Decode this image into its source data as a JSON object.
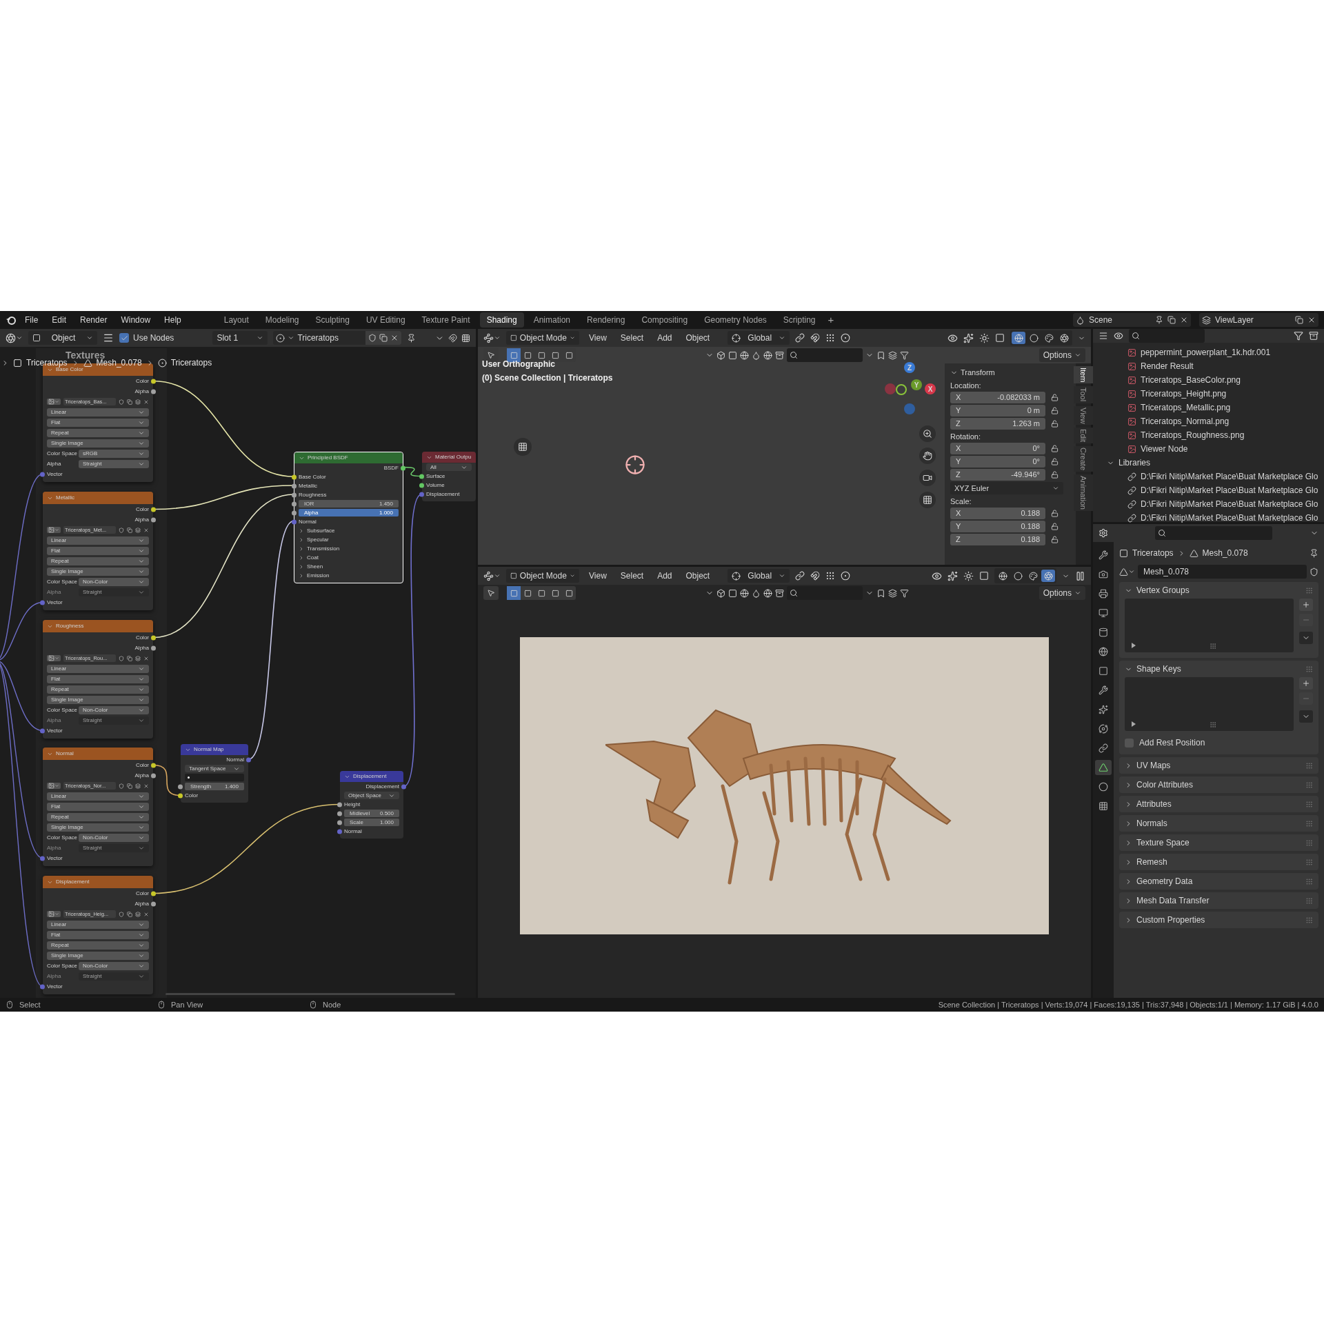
{
  "menubar": {
    "items": [
      "File",
      "Edit",
      "Render",
      "Window",
      "Help"
    ],
    "workspaces": [
      {
        "label": "Layout",
        "selected": false
      },
      {
        "label": "Modeling",
        "selected": false
      },
      {
        "label": "Sculpting",
        "selected": false
      },
      {
        "label": "UV Editing",
        "selected": false
      },
      {
        "label": "Texture Paint",
        "selected": false
      },
      {
        "label": "Shading",
        "selected": true
      },
      {
        "label": "Animation",
        "selected": false
      },
      {
        "label": "Rendering",
        "selected": false
      },
      {
        "label": "Compositing",
        "selected": false
      },
      {
        "label": "Geometry Nodes",
        "selected": false
      },
      {
        "label": "Scripting",
        "selected": false
      }
    ],
    "add_tab": "+",
    "scene": "Scene",
    "view_layer": "ViewLayer"
  },
  "node_editor": {
    "header": {
      "mode": "Object",
      "use_nodes": {
        "label": "Use Nodes",
        "checked": true
      },
      "slot": "Slot 1",
      "material": "Triceratops"
    },
    "frame_label": "Textures",
    "breadcrumb": [
      "Triceratops",
      "Mesh_0.078",
      "Triceratops"
    ],
    "image_nodes": [
      {
        "label": "Base Color",
        "image": "Triceratops_Bas...",
        "interpolation": "Linear",
        "projection": "Flat",
        "extension": "Repeat",
        "source": "Single Image",
        "color_space_label": "Color Space",
        "color_space": "sRGB",
        "alpha_label": "Alpha",
        "alpha": "Straight",
        "alpha_enabled": true,
        "outputs": [
          "Color",
          "Alpha"
        ],
        "input": "Vector"
      },
      {
        "label": "Metallic",
        "image": "Triceratops_Met...",
        "interpolation": "Linear",
        "projection": "Flat",
        "extension": "Repeat",
        "source": "Single Image",
        "color_space_label": "Color Space",
        "color_space": "Non-Color",
        "alpha_label": "Alpha",
        "alpha": "Straight",
        "alpha_enabled": false,
        "outputs": [
          "Color",
          "Alpha"
        ],
        "input": "Vector"
      },
      {
        "label": "Roughness",
        "image": "Triceratops_Rou...",
        "interpolation": "Linear",
        "projection": "Flat",
        "extension": "Repeat",
        "source": "Single Image",
        "color_space_label": "Color Space",
        "color_space": "Non-Color",
        "alpha_label": "Alpha",
        "alpha": "Straight",
        "alpha_enabled": false,
        "outputs": [
          "Color",
          "Alpha"
        ],
        "input": "Vector"
      },
      {
        "label": "Normal",
        "image": "Triceratops_Nor...",
        "interpolation": "Linear",
        "projection": "Flat",
        "extension": "Repeat",
        "source": "Single Image",
        "color_space_label": "Color Space",
        "color_space": "Non-Color",
        "alpha_label": "Alpha",
        "alpha": "Straight",
        "alpha_enabled": false,
        "outputs": [
          "Color",
          "Alpha"
        ],
        "input": "Vector"
      },
      {
        "label": "Displacement",
        "image": "Triceratops_Heig...",
        "interpolation": "Linear",
        "projection": "Flat",
        "extension": "Repeat",
        "source": "Single Image",
        "color_space_label": "Color Space",
        "color_space": "Non-Color",
        "alpha_label": "Alpha",
        "alpha": "Straight",
        "alpha_enabled": false,
        "outputs": [
          "Color",
          "Alpha"
        ],
        "input": "Vector"
      }
    ],
    "principled": {
      "title": "Principled BSDF",
      "output": "BSDF",
      "inputs": [
        "Base Color",
        "Metallic",
        "Roughness"
      ],
      "sliders": [
        {
          "label": "IOR",
          "value": "1.450",
          "selected": false
        },
        {
          "label": "Alpha",
          "value": "1.000",
          "selected": true
        }
      ],
      "normal": "Normal",
      "panels": [
        "Subsurface",
        "Specular",
        "Transmission",
        "Coat",
        "Sheen",
        "Emission"
      ]
    },
    "material_output": {
      "title": "Material Outpu",
      "target": "All",
      "inputs": [
        "Surface",
        "Volume",
        "Displacement"
      ]
    },
    "normal_map": {
      "title": "Normal Map",
      "output": "Normal",
      "space": "Tangent Space",
      "strength": {
        "label": "Strength",
        "value": "1.400",
        "selected": false
      },
      "input": "Color"
    },
    "displacement": {
      "title": "Displacement",
      "output": "Displacement",
      "space": "Object Space",
      "height": "Height",
      "sliders": [
        {
          "label": "Midlevel",
          "value": "0.500",
          "selected": false
        },
        {
          "label": "Scale",
          "value": "1.000",
          "selected": false
        }
      ],
      "normal": "Normal"
    }
  },
  "viewports": [
    {
      "kind": "scene",
      "header": {
        "mode": "Object Mode",
        "menus": [
          "View",
          "Select",
          "Add",
          "Object"
        ],
        "orientation": "Global",
        "options": "Options"
      },
      "shading": [
        {
          "kind": "wireframe",
          "selected": true
        },
        {
          "kind": "solid",
          "selected": false
        },
        {
          "kind": "material",
          "selected": false
        },
        {
          "kind": "rendered",
          "selected": false
        }
      ],
      "overlay": [
        "User Orthographic",
        "(0) Scene Collection | Triceratops"
      ],
      "gizmo": [
        "Z",
        "Y",
        "X"
      ],
      "transform": {
        "title": "Transform",
        "groups": [
          {
            "label": "Location:",
            "fields": [
              {
                "axis": "X",
                "value": "-0.082033 m"
              },
              {
                "axis": "Y",
                "value": "0 m"
              },
              {
                "axis": "Z",
                "value": "1.263 m"
              }
            ]
          },
          {
            "label": "Rotation:",
            "fields": [
              {
                "axis": "X",
                "value": "0°"
              },
              {
                "axis": "Y",
                "value": "0°"
              },
              {
                "axis": "Z",
                "value": "-49.946°"
              }
            ],
            "mode": "XYZ Euler"
          },
          {
            "label": "Scale:",
            "fields": [
              {
                "axis": "X",
                "value": "0.188"
              },
              {
                "axis": "Y",
                "value": "0.188"
              },
              {
                "axis": "Z",
                "value": "0.188"
              }
            ]
          }
        ]
      },
      "tabs": [
        {
          "label": "Item",
          "selected": true
        },
        {
          "label": "Tool",
          "selected": false
        },
        {
          "label": "View",
          "selected": false
        },
        {
          "label": "Edit",
          "selected": false
        },
        {
          "label": "Create",
          "selected": false
        },
        {
          "label": "Animation",
          "selected": false
        }
      ]
    },
    {
      "kind": "render",
      "header": {
        "mode": "Object Mode",
        "menus": [
          "View",
          "Select",
          "Add",
          "Object"
        ],
        "orientation": "Global",
        "options": "Options"
      },
      "shading": [
        {
          "kind": "wireframe",
          "selected": false
        },
        {
          "kind": "solid",
          "selected": false
        },
        {
          "kind": "material",
          "selected": false
        },
        {
          "kind": "rendered",
          "selected": true
        }
      ]
    }
  ],
  "outliner": {
    "items": [
      {
        "label": "peppermint_powerplant_1k.hdr.001",
        "kind": "image"
      },
      {
        "label": "Render Result",
        "kind": "image"
      },
      {
        "label": "Triceratops_BaseColor.png",
        "kind": "image"
      },
      {
        "label": "Triceratops_Height.png",
        "kind": "image"
      },
      {
        "label": "Triceratops_Metallic.png",
        "kind": "image"
      },
      {
        "label": "Triceratops_Normal.png",
        "kind": "image"
      },
      {
        "label": "Triceratops_Roughness.png",
        "kind": "image"
      },
      {
        "label": "Viewer Node",
        "kind": "image"
      },
      {
        "label": "Libraries",
        "kind": "group",
        "expanded": true,
        "children": [
          {
            "label": "D:\\Fikri Nitip\\Market Place\\Buat Marketplace Glo",
            "kind": "library"
          },
          {
            "label": "D:\\Fikri Nitip\\Market Place\\Buat Marketplace Glo",
            "kind": "library"
          },
          {
            "label": "D:\\Fikri Nitip\\Market Place\\Buat Marketplace Glo",
            "kind": "library"
          },
          {
            "label": "D:\\Fikri Nitip\\Market Place\\Buat Marketplace Glo",
            "kind": "library"
          }
        ]
      }
    ]
  },
  "properties": {
    "tabs": [
      {
        "kind": "tool",
        "selected": false
      },
      {
        "kind": "render",
        "selected": false
      },
      {
        "kind": "output",
        "selected": false
      },
      {
        "kind": "view_layer",
        "selected": false
      },
      {
        "kind": "scene",
        "selected": false
      },
      {
        "kind": "world",
        "selected": false
      },
      {
        "kind": "object",
        "selected": false
      },
      {
        "kind": "modifiers",
        "selected": false
      },
      {
        "kind": "particles",
        "selected": false
      },
      {
        "kind": "physics",
        "selected": false
      },
      {
        "kind": "constraints",
        "selected": false
      },
      {
        "kind": "data",
        "selected": true
      },
      {
        "kind": "material",
        "selected": false
      },
      {
        "kind": "texture",
        "selected": false
      }
    ],
    "breadcrumb": [
      "Triceratops",
      "Mesh_0.078"
    ],
    "datablock": "Mesh_0.078",
    "panels": [
      {
        "title": "Vertex Groups",
        "expanded": true,
        "kind": "list"
      },
      {
        "title": "Shape Keys",
        "expanded": true,
        "kind": "list",
        "option": {
          "label": "Add Rest Position",
          "checked": false
        }
      },
      {
        "title": "UV Maps",
        "expanded": false
      },
      {
        "title": "Color Attributes",
        "expanded": false
      },
      {
        "title": "Attributes",
        "expanded": false
      },
      {
        "title": "Normals",
        "expanded": false
      },
      {
        "title": "Texture Space",
        "expanded": false
      },
      {
        "title": "Remesh",
        "expanded": false
      },
      {
        "title": "Geometry Data",
        "expanded": false
      },
      {
        "title": "Mesh Data Transfer",
        "expanded": false
      },
      {
        "title": "Custom Properties",
        "expanded": false
      }
    ]
  },
  "status_bar": {
    "hints": [
      "Select",
      "Pan View",
      "Node"
    ],
    "stats": "Scene Collection | Triceratops | Verts:19,074 | Faces:19,135 | Tris:37,948 | Objects:1/1 | Memory: 1.17 GiB | 4.0.0"
  }
}
